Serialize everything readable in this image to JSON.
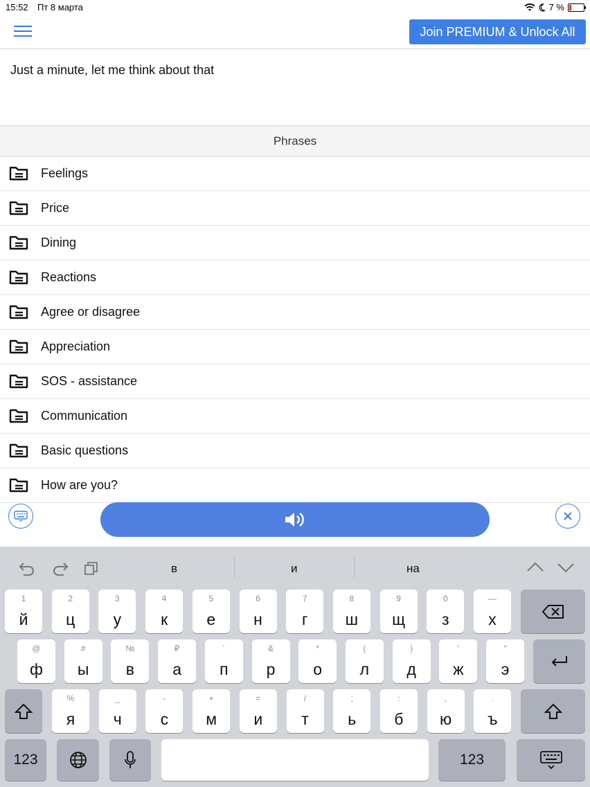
{
  "status": {
    "time": "15:52",
    "date": "Пт 8 марта",
    "battery": "7 %"
  },
  "header": {
    "premium_label": "Join PREMIUM & Unlock All"
  },
  "input": {
    "text": "Just a minute, let me think about that"
  },
  "section": {
    "title": "Phrases"
  },
  "categories": [
    "Feelings",
    "Price",
    "Dining",
    "Reactions",
    "Agree or disagree",
    "Appreciation",
    "SOS - assistance",
    "Communication",
    "Basic questions",
    "How are you?"
  ],
  "keyboard": {
    "suggestions": [
      "в",
      "и",
      "на"
    ],
    "row1": [
      {
        "main": "й",
        "sub": "1"
      },
      {
        "main": "ц",
        "sub": "2"
      },
      {
        "main": "у",
        "sub": "3"
      },
      {
        "main": "к",
        "sub": "4"
      },
      {
        "main": "е",
        "sub": "5"
      },
      {
        "main": "н",
        "sub": "6"
      },
      {
        "main": "г",
        "sub": "7"
      },
      {
        "main": "ш",
        "sub": "8"
      },
      {
        "main": "щ",
        "sub": "9"
      },
      {
        "main": "з",
        "sub": "0"
      },
      {
        "main": "х",
        "sub": "—"
      }
    ],
    "row2": [
      {
        "main": "ф",
        "sub": "@"
      },
      {
        "main": "ы",
        "sub": "#"
      },
      {
        "main": "в",
        "sub": "№"
      },
      {
        "main": "а",
        "sub": "₽"
      },
      {
        "main": "п",
        "sub": "´"
      },
      {
        "main": "р",
        "sub": "&"
      },
      {
        "main": "о",
        "sub": "*"
      },
      {
        "main": "л",
        "sub": "("
      },
      {
        "main": "д",
        "sub": ")"
      },
      {
        "main": "ж",
        "sub": "′"
      },
      {
        "main": "э",
        "sub": "″"
      }
    ],
    "row3": [
      {
        "main": "я",
        "sub": "%"
      },
      {
        "main": "ч",
        "sub": "_"
      },
      {
        "main": "с",
        "sub": "-"
      },
      {
        "main": "м",
        "sub": "+"
      },
      {
        "main": "и",
        "sub": "="
      },
      {
        "main": "т",
        "sub": "/"
      },
      {
        "main": "ь",
        "sub": ";"
      },
      {
        "main": "б",
        "sub": ":"
      },
      {
        "main": "ю",
        "sub": ","
      },
      {
        "main": "ъ",
        "sub": "."
      }
    ],
    "numbers_label": "123"
  },
  "colors": {
    "accent": "#3e7fe6",
    "speak_button": "#5080e0",
    "keyboard_bg": "#d1d4d9"
  }
}
